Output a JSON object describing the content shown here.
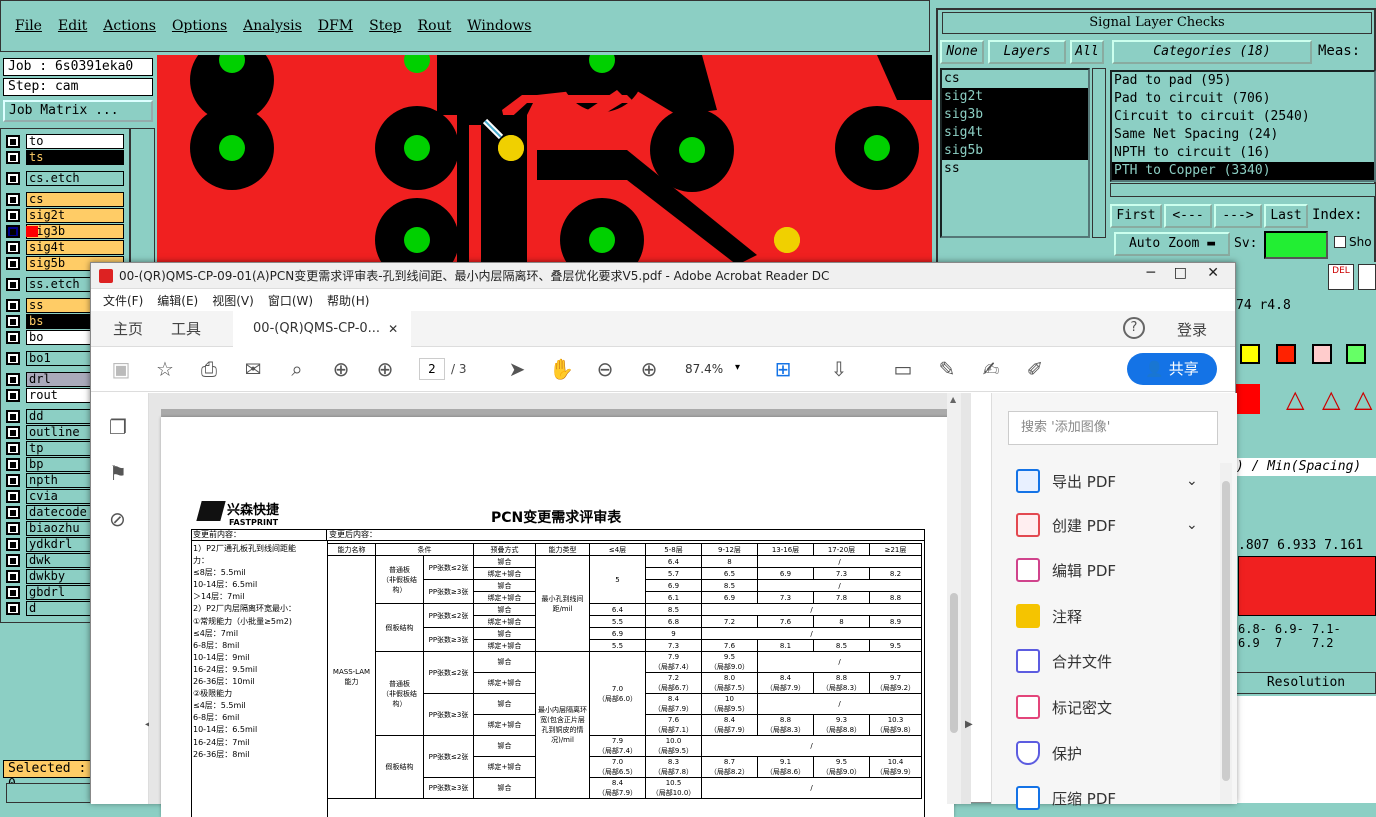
{
  "cam": {
    "menu": [
      "File",
      "Edit",
      "Actions",
      "Options",
      "Analysis",
      "DFM",
      "Step",
      "Rout",
      "Windows"
    ],
    "job_label": "Job : 6s0391eka0",
    "step_label": "Step: cam",
    "job_matrix_button": "Job Matrix ...",
    "layers": [
      "to",
      "ts",
      "cs.etch",
      "cs",
      "sig2t",
      "sig3b",
      "sig4t",
      "sig5b",
      "ss.etch",
      "ss",
      "bs",
      "bo",
      "bo1",
      "drl",
      "rout",
      "dd",
      "outline",
      "tp",
      "bp",
      "npth",
      "cvia",
      "datecode",
      "biaozhu",
      "ydkdrl",
      "dwk",
      "dwkby",
      "gbdrl",
      "d"
    ],
    "selected_label": "Selected : 0"
  },
  "signal_checks": {
    "title": "Signal Layer Checks",
    "none_button": "None",
    "layers_button": "Layers",
    "all_button": "All",
    "layer_list": [
      "cs",
      "sig2t",
      "sig3b",
      "sig4t",
      "sig5b",
      "ss"
    ],
    "categories_header": "Categories (18)",
    "meas_label": "Meas:",
    "categories": [
      "Pad to pad (95)",
      "Pad to circuit (706)",
      "Circuit to circuit (2540)",
      "Same Net Spacing (24)",
      "NPTH to circuit (16)",
      "PTH to Copper (3340)"
    ],
    "first_button": "First",
    "prev_button": "<---",
    "next_button": "--->",
    "last_button": "Last",
    "index_label": "Index:",
    "auto_zoom_button": "Auto Zoom",
    "sv_label": "Sv:",
    "show_label": "Sho",
    "del_label": "DEL",
    "r_value": "74  r4.8",
    "spacing_header": ") / Min(Spacing)",
    "bars_values": [
      ".807",
      "6.933",
      "7.161"
    ],
    "bar_ranges": [
      "6.8-\n6.9",
      "6.9-\n7",
      "7.1-\n7.2"
    ],
    "resolution_label": "Resolution"
  },
  "acrobat": {
    "title": "00-(QR)QMS-CP-09-01(A)PCN变更需求评审表-孔到线间距、最小内层隔离环、叠层优化要求V5.pdf - Adobe Acrobat Reader DC",
    "menu": [
      "文件(F)",
      "编辑(E)",
      "视图(V)",
      "窗口(W)",
      "帮助(H)"
    ],
    "tab_home": "主页",
    "tab_tools": "工具",
    "tab_doc": "00-(QR)QMS-CP-0...",
    "login": "登录",
    "page_current": "2",
    "page_total": "/ 3",
    "zoom": "87.4%",
    "share": "共享",
    "search_placeholder": "搜索 '添加图像'",
    "right_panel": [
      "导出 PDF",
      "创建 PDF",
      "编辑 PDF",
      "注释",
      "合并文件",
      "标记密文",
      "保护",
      "压缩 PDF"
    ]
  },
  "doc": {
    "logo_cn": "兴森快捷",
    "logo_en": "FASTPRINT",
    "heading": "PCN变更需求评审表",
    "before_label": "变更前内容：",
    "after_label": "变更后内容：",
    "before_lines": [
      "1）P2厂通孔板孔到线间距能",
      "力：",
      "≤8层：5.5mil",
      "10-14层：6.5mil",
      "＞14层：7mil",
      "2）P2厂内层隔离环宽最小：",
      "①常规能力（小批量≥5m2)",
      "≤4层：7mil",
      "6-8层：8mil",
      "10-14层：9mil",
      "16-24层：9.5mil",
      "26-36层：10mil",
      "②极限能力",
      "≤4层：5.5mil",
      "6-8层：6mil",
      "10-14层：6.5mil",
      "16-24层：7mil",
      "26-36层：8mil"
    ],
    "table_headers": [
      "能力名称",
      "条件",
      "",
      "预叠方式",
      "能力类型",
      "≤4层",
      "5-8层",
      "9-12层",
      "13-16层",
      "17-20层",
      "≥21层"
    ],
    "mass_lam": "MASS-LAM\n能力",
    "cond_normal": "普通板\n（非假板结构）",
    "cond_fake": "假板结构",
    "pp_le2": "PP张数≤2张",
    "pp_ge3": "PP张数≥3张",
    "bond": "铆合",
    "bond_hot": "绑定+铆合",
    "type_hole": "最小孔到线间距/mil",
    "type_ring": "最小内层隔离环宽(包含正片层孔到铜皮的情况)/mil",
    "rows_hole": [
      [
        "6.4",
        "8",
        "/",
        "",
        ""
      ],
      [
        "5.7",
        "6.5",
        "6.9",
        "7.3",
        "8.2"
      ],
      [
        "6.9",
        "8.5",
        "/",
        "",
        ""
      ],
      [
        "6.1",
        "6.9",
        "7.3",
        "7.8",
        "8.8"
      ],
      [
        "6.4",
        "8.5",
        "/",
        "",
        ""
      ],
      [
        "5.5",
        "6.8",
        "7.2",
        "7.6",
        "8",
        "8.9"
      ],
      [
        "6.9",
        "9",
        "/",
        "",
        ""
      ],
      [
        "5.5",
        "7.3",
        "7.6",
        "8.1",
        "8.5",
        "9.5"
      ]
    ],
    "ring_cells": {
      "c44": "7.0\n（局部6.0）",
      "r1": [
        "7.9\n（局部7.4）",
        "9.5\n（局部9.0）",
        "/"
      ],
      "r2": [
        "7.2\n（局部6.7）",
        "8.0\n（局部7.5）",
        "8.4\n（局部7.9）",
        "8.8\n（局部8.3）",
        "9.7\n（局部9.2）"
      ],
      "r3": [
        "8.4\n（局部7.9）",
        "10\n（局部9.5）",
        "/"
      ],
      "r4": [
        "7.6\n（局部7.1）",
        "8.4\n（局部7.9）",
        "8.8\n（局部8.3）",
        "9.3\n（局部8.8）",
        "10.3\n（局部9.8）"
      ],
      "r5": [
        "7.9\n（局部7.4）",
        "10.0\n（局部9.5）",
        "/"
      ],
      "r6": [
        "7.0\n（局部6.5）",
        "8.3\n（局部7.8）",
        "8.7\n（局部8.2）",
        "9.1\n（局部8.6）",
        "9.5\n（局部9.0）",
        "10.4\n（局部9.9）"
      ],
      "r7": [
        "8.4\n（局部7.9）",
        "10.5\n（局部10.0）",
        "/"
      ]
    }
  }
}
